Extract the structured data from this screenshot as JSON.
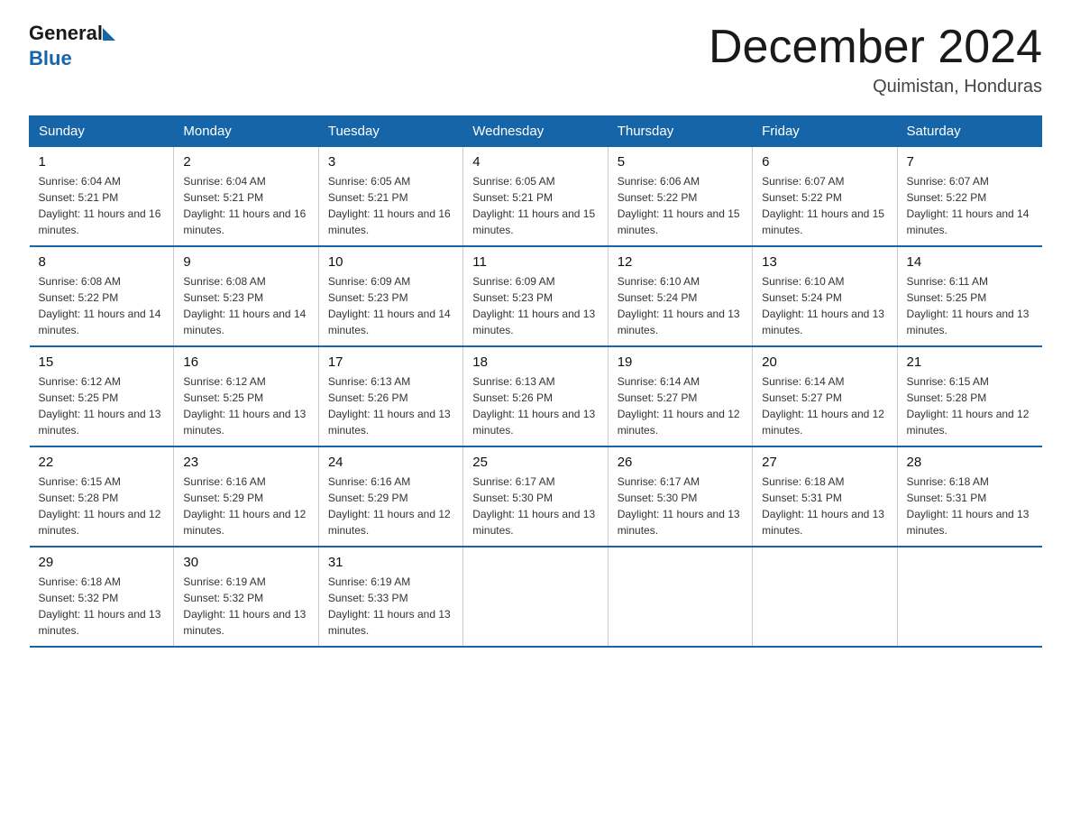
{
  "header": {
    "logo_general": "General",
    "logo_blue": "Blue",
    "month_title": "December 2024",
    "location": "Quimistan, Honduras"
  },
  "weekdays": [
    "Sunday",
    "Monday",
    "Tuesday",
    "Wednesday",
    "Thursday",
    "Friday",
    "Saturday"
  ],
  "weeks": [
    [
      {
        "day": "1",
        "sunrise": "6:04 AM",
        "sunset": "5:21 PM",
        "daylight": "11 hours and 16 minutes."
      },
      {
        "day": "2",
        "sunrise": "6:04 AM",
        "sunset": "5:21 PM",
        "daylight": "11 hours and 16 minutes."
      },
      {
        "day": "3",
        "sunrise": "6:05 AM",
        "sunset": "5:21 PM",
        "daylight": "11 hours and 16 minutes."
      },
      {
        "day": "4",
        "sunrise": "6:05 AM",
        "sunset": "5:21 PM",
        "daylight": "11 hours and 15 minutes."
      },
      {
        "day": "5",
        "sunrise": "6:06 AM",
        "sunset": "5:22 PM",
        "daylight": "11 hours and 15 minutes."
      },
      {
        "day": "6",
        "sunrise": "6:07 AM",
        "sunset": "5:22 PM",
        "daylight": "11 hours and 15 minutes."
      },
      {
        "day": "7",
        "sunrise": "6:07 AM",
        "sunset": "5:22 PM",
        "daylight": "11 hours and 14 minutes."
      }
    ],
    [
      {
        "day": "8",
        "sunrise": "6:08 AM",
        "sunset": "5:22 PM",
        "daylight": "11 hours and 14 minutes."
      },
      {
        "day": "9",
        "sunrise": "6:08 AM",
        "sunset": "5:23 PM",
        "daylight": "11 hours and 14 minutes."
      },
      {
        "day": "10",
        "sunrise": "6:09 AM",
        "sunset": "5:23 PM",
        "daylight": "11 hours and 14 minutes."
      },
      {
        "day": "11",
        "sunrise": "6:09 AM",
        "sunset": "5:23 PM",
        "daylight": "11 hours and 13 minutes."
      },
      {
        "day": "12",
        "sunrise": "6:10 AM",
        "sunset": "5:24 PM",
        "daylight": "11 hours and 13 minutes."
      },
      {
        "day": "13",
        "sunrise": "6:10 AM",
        "sunset": "5:24 PM",
        "daylight": "11 hours and 13 minutes."
      },
      {
        "day": "14",
        "sunrise": "6:11 AM",
        "sunset": "5:25 PM",
        "daylight": "11 hours and 13 minutes."
      }
    ],
    [
      {
        "day": "15",
        "sunrise": "6:12 AM",
        "sunset": "5:25 PM",
        "daylight": "11 hours and 13 minutes."
      },
      {
        "day": "16",
        "sunrise": "6:12 AM",
        "sunset": "5:25 PM",
        "daylight": "11 hours and 13 minutes."
      },
      {
        "day": "17",
        "sunrise": "6:13 AM",
        "sunset": "5:26 PM",
        "daylight": "11 hours and 13 minutes."
      },
      {
        "day": "18",
        "sunrise": "6:13 AM",
        "sunset": "5:26 PM",
        "daylight": "11 hours and 13 minutes."
      },
      {
        "day": "19",
        "sunrise": "6:14 AM",
        "sunset": "5:27 PM",
        "daylight": "11 hours and 12 minutes."
      },
      {
        "day": "20",
        "sunrise": "6:14 AM",
        "sunset": "5:27 PM",
        "daylight": "11 hours and 12 minutes."
      },
      {
        "day": "21",
        "sunrise": "6:15 AM",
        "sunset": "5:28 PM",
        "daylight": "11 hours and 12 minutes."
      }
    ],
    [
      {
        "day": "22",
        "sunrise": "6:15 AM",
        "sunset": "5:28 PM",
        "daylight": "11 hours and 12 minutes."
      },
      {
        "day": "23",
        "sunrise": "6:16 AM",
        "sunset": "5:29 PM",
        "daylight": "11 hours and 12 minutes."
      },
      {
        "day": "24",
        "sunrise": "6:16 AM",
        "sunset": "5:29 PM",
        "daylight": "11 hours and 12 minutes."
      },
      {
        "day": "25",
        "sunrise": "6:17 AM",
        "sunset": "5:30 PM",
        "daylight": "11 hours and 13 minutes."
      },
      {
        "day": "26",
        "sunrise": "6:17 AM",
        "sunset": "5:30 PM",
        "daylight": "11 hours and 13 minutes."
      },
      {
        "day": "27",
        "sunrise": "6:18 AM",
        "sunset": "5:31 PM",
        "daylight": "11 hours and 13 minutes."
      },
      {
        "day": "28",
        "sunrise": "6:18 AM",
        "sunset": "5:31 PM",
        "daylight": "11 hours and 13 minutes."
      }
    ],
    [
      {
        "day": "29",
        "sunrise": "6:18 AM",
        "sunset": "5:32 PM",
        "daylight": "11 hours and 13 minutes."
      },
      {
        "day": "30",
        "sunrise": "6:19 AM",
        "sunset": "5:32 PM",
        "daylight": "11 hours and 13 minutes."
      },
      {
        "day": "31",
        "sunrise": "6:19 AM",
        "sunset": "5:33 PM",
        "daylight": "11 hours and 13 minutes."
      },
      null,
      null,
      null,
      null
    ]
  ]
}
